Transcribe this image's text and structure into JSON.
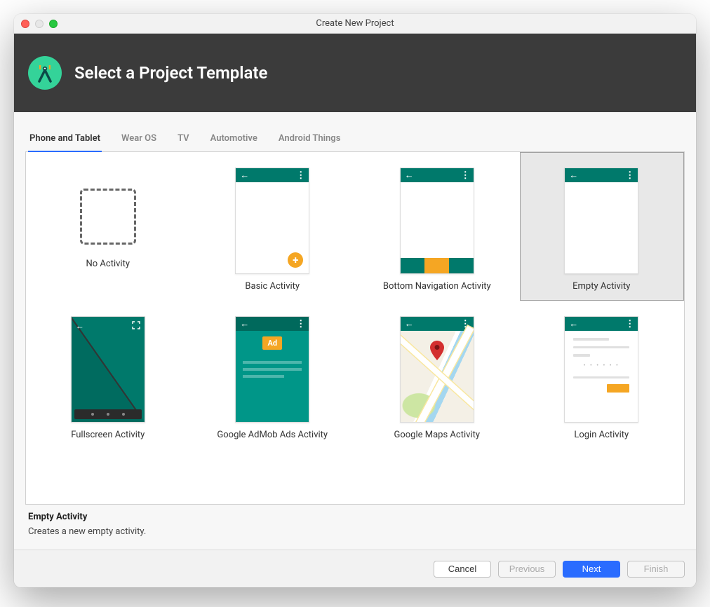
{
  "window_title": "Create New Project",
  "page_title": "Select a Project Template",
  "tabs": [
    {
      "label": "Phone and Tablet",
      "active": true
    },
    {
      "label": "Wear OS",
      "active": false
    },
    {
      "label": "TV",
      "active": false
    },
    {
      "label": "Automotive",
      "active": false
    },
    {
      "label": "Android Things",
      "active": false
    }
  ],
  "templates": [
    {
      "id": "no-activity",
      "label": "No Activity",
      "selected": false
    },
    {
      "id": "basic-activity",
      "label": "Basic Activity",
      "selected": false
    },
    {
      "id": "bottom-nav-activity",
      "label": "Bottom Navigation Activity",
      "selected": false
    },
    {
      "id": "empty-activity",
      "label": "Empty Activity",
      "selected": true
    },
    {
      "id": "fullscreen-activity",
      "label": "Fullscreen Activity",
      "selected": false
    },
    {
      "id": "admob-activity",
      "label": "Google AdMob Ads Activity",
      "selected": false
    },
    {
      "id": "maps-activity",
      "label": "Google Maps Activity",
      "selected": false
    },
    {
      "id": "login-activity",
      "label": "Login Activity",
      "selected": false
    }
  ],
  "ad_badge_text": "Ad",
  "selection": {
    "title": "Empty Activity",
    "description": "Creates a new empty activity."
  },
  "buttons": {
    "cancel": "Cancel",
    "previous": "Previous",
    "next": "Next",
    "finish": "Finish"
  },
  "accent_teal": "#00796b",
  "accent_orange": "#f5a623"
}
